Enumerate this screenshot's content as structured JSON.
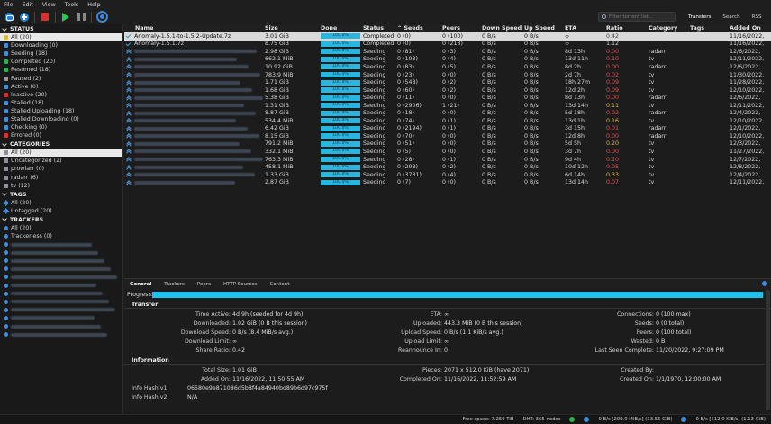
{
  "menu": {
    "file": "File",
    "edit": "Edit",
    "view": "View",
    "tools": "Tools",
    "help": "Help"
  },
  "search": {
    "placeholder": "Filter torrent list..."
  },
  "navtabs": {
    "transfers": "Transfers",
    "search": "Search",
    "rss": "RSS"
  },
  "sidebar": {
    "status_header": "STATUS",
    "status": [
      {
        "label": "All (20)",
        "color": "#e8b53a"
      },
      {
        "label": "Downloading (0)",
        "color": "#3a8fe0"
      },
      {
        "label": "Seeding (18)",
        "color": "#3a8fe0"
      },
      {
        "label": "Completed (20)",
        "color": "#2fb24c"
      },
      {
        "label": "Resumed (18)",
        "color": "#2fb24c"
      },
      {
        "label": "Paused (2)",
        "color": "#999999"
      },
      {
        "label": "Active (0)",
        "color": "#3a8fe0"
      },
      {
        "label": "Inactive (20)",
        "color": "#d9302c"
      },
      {
        "label": "Stalled (18)",
        "color": "#3a8fe0"
      },
      {
        "label": "Stalled Uploading (18)",
        "color": "#3a8fe0"
      },
      {
        "label": "Stalled Downloading (0)",
        "color": "#3a8fe0"
      },
      {
        "label": "Checking (0)",
        "color": "#3a8fe0"
      },
      {
        "label": "Errored (0)",
        "color": "#d9302c"
      }
    ],
    "categories_header": "CATEGORIES",
    "categories": [
      "All (20)",
      "Uncategorized (2)",
      "prowlarr (0)",
      "radarr (6)",
      "tv (12)"
    ],
    "tags_header": "TAGS",
    "tags": [
      "All (20)",
      "Untagged (20)"
    ],
    "trackers_header": "TRACKERS",
    "trackers": [
      "All (20)",
      "Trackerless (0)"
    ]
  },
  "columns": {
    "name": "Name",
    "size": "Size",
    "done": "Done",
    "status": "Status",
    "seeds": "Seeds",
    "peers": "Peers",
    "down": "Down Speed",
    "up": "Up Speed",
    "eta": "ETA",
    "ratio": "Ratio",
    "category": "Category",
    "tags": "Tags",
    "added": "Added On"
  },
  "rows": [
    {
      "name": "Anomaly-1.5.1-to-1.5.2-Update.7z",
      "size": "3.01 GiB",
      "done": "100.0%",
      "status": "Completed",
      "seeds": "0 (0)",
      "peers": "0 (100)",
      "down": "0 B/s",
      "up": "0 B/s",
      "eta": "∞",
      "ratio": "0.42",
      "ratio_color": "#444444",
      "category": "",
      "added": "11/16/2022,"
    },
    {
      "name": "Anomaly-1.5.1.7z",
      "size": "8.75 GiB",
      "done": "100.0%",
      "status": "Completed",
      "seeds": "0 (0)",
      "peers": "0 (213)",
      "down": "0 B/s",
      "up": "0 B/s",
      "eta": "∞",
      "ratio": "1.12",
      "ratio_color": "#d4d4d4",
      "category": "",
      "added": "11/16/2022,"
    },
    {
      "name": "",
      "size": "2.98 GiB",
      "done": "100.0%",
      "status": "Seeding",
      "seeds": "0 (81)",
      "peers": "0 (3)",
      "down": "0 B/s",
      "up": "0 B/s",
      "eta": "8d 13h",
      "ratio": "0.00",
      "ratio_color": "#e05050",
      "category": "radarr",
      "added": "12/6/2022,"
    },
    {
      "name": "",
      "size": "662.1 MiB",
      "done": "100.0%",
      "status": "Seeding",
      "seeds": "0 (193)",
      "peers": "0 (4)",
      "down": "0 B/s",
      "up": "0 B/s",
      "eta": "13d 11h",
      "ratio": "0.10",
      "ratio_color": "#e05050",
      "category": "tv",
      "added": "12/11/2022,"
    },
    {
      "name": "",
      "size": "10.92 GiB",
      "done": "100.0%",
      "status": "Seeding",
      "seeds": "0 (83)",
      "peers": "0 (5)",
      "down": "0 B/s",
      "up": "0 B/s",
      "eta": "8d 2h",
      "ratio": "0.00",
      "ratio_color": "#e05050",
      "category": "radarr",
      "added": "12/6/2022,"
    },
    {
      "name": "",
      "size": "783.9 MiB",
      "done": "100.0%",
      "status": "Seeding",
      "seeds": "0 (23)",
      "peers": "0 (0)",
      "down": "0 B/s",
      "up": "0 B/s",
      "eta": "2d 7h",
      "ratio": "0.02",
      "ratio_color": "#e05050",
      "category": "tv",
      "added": "11/30/2022,"
    },
    {
      "name": "",
      "size": "1.71 GiB",
      "done": "100.0%",
      "status": "Seeding",
      "seeds": "0 (548)",
      "peers": "0 (2)",
      "down": "0 B/s",
      "up": "0 B/s",
      "eta": "18h 27m",
      "ratio": "0.09",
      "ratio_color": "#e05050",
      "category": "tv",
      "added": "11/28/2022,"
    },
    {
      "name": "",
      "size": "1.68 GiB",
      "done": "100.0%",
      "status": "Seeding",
      "seeds": "0 (60)",
      "peers": "0 (2)",
      "down": "0 B/s",
      "up": "0 B/s",
      "eta": "12d 2h",
      "ratio": "0.09",
      "ratio_color": "#e05050",
      "category": "tv",
      "added": "12/10/2022,"
    },
    {
      "name": "",
      "size": "5.38 GiB",
      "done": "100.0%",
      "status": "Seeding",
      "seeds": "0 (11)",
      "peers": "0 (0)",
      "down": "0 B/s",
      "up": "0 B/s",
      "eta": "8d 13h",
      "ratio": "0.00",
      "ratio_color": "#e05050",
      "category": "radarr",
      "added": "12/6/2022,"
    },
    {
      "name": "",
      "size": "1.31 GiB",
      "done": "100.0%",
      "status": "Seeding",
      "seeds": "0 (2906)",
      "peers": "1 (21)",
      "down": "0 B/s",
      "up": "0 B/s",
      "eta": "13d 14h",
      "ratio": "0.11",
      "ratio_color": "#e6b84a",
      "category": "tv",
      "added": "12/11/2022,"
    },
    {
      "name": "",
      "size": "8.87 GiB",
      "done": "100.0%",
      "status": "Seeding",
      "seeds": "0 (18)",
      "peers": "0 (0)",
      "down": "0 B/s",
      "up": "0 B/s",
      "eta": "5d 18h",
      "ratio": "0.02",
      "ratio_color": "#e05050",
      "category": "radarr",
      "added": "12/4/2022,"
    },
    {
      "name": "",
      "size": "534.4 MiB",
      "done": "100.0%",
      "status": "Seeding",
      "seeds": "0 (74)",
      "peers": "0 (1)",
      "down": "0 B/s",
      "up": "0 B/s",
      "eta": "13d 1h",
      "ratio": "0.16",
      "ratio_color": "#e6b84a",
      "category": "tv",
      "added": "12/10/2022,"
    },
    {
      "name": "",
      "size": "6.42 GiB",
      "done": "100.0%",
      "status": "Seeding",
      "seeds": "0 (2194)",
      "peers": "0 (1)",
      "down": "0 B/s",
      "up": "0 B/s",
      "eta": "3d 15h",
      "ratio": "0.01",
      "ratio_color": "#e05050",
      "category": "radarr",
      "added": "12/1/2022,"
    },
    {
      "name": "",
      "size": "8.15 GiB",
      "done": "100.0%",
      "status": "Seeding",
      "seeds": "0 (70)",
      "peers": "0 (0)",
      "down": "0 B/s",
      "up": "0 B/s",
      "eta": "12d 8h",
      "ratio": "0.00",
      "ratio_color": "#e05050",
      "category": "radarr",
      "added": "12/10/2022,"
    },
    {
      "name": "",
      "size": "791.2 MiB",
      "done": "100.0%",
      "status": "Seeding",
      "seeds": "0 (51)",
      "peers": "0 (0)",
      "down": "0 B/s",
      "up": "0 B/s",
      "eta": "5d 5h",
      "ratio": "0.20",
      "ratio_color": "#e6b84a",
      "category": "tv",
      "added": "12/3/2022,"
    },
    {
      "name": "",
      "size": "332.1 MiB",
      "done": "100.0%",
      "status": "Seeding",
      "seeds": "0 (5)",
      "peers": "0 (0)",
      "down": "0 B/s",
      "up": "0 B/s",
      "eta": "3d 7h",
      "ratio": "0.00",
      "ratio_color": "#e05050",
      "category": "tv",
      "added": "11/27/2022,"
    },
    {
      "name": "",
      "size": "763.3 MiB",
      "done": "100.0%",
      "status": "Seeding",
      "seeds": "0 (28)",
      "peers": "0 (1)",
      "down": "0 B/s",
      "up": "0 B/s",
      "eta": "9d 4h",
      "ratio": "0.10",
      "ratio_color": "#e05050",
      "category": "tv",
      "added": "12/7/2022,"
    },
    {
      "name": "",
      "size": "458.1 MiB",
      "done": "100.0%",
      "status": "Seeding",
      "seeds": "0 (298)",
      "peers": "0 (2)",
      "down": "0 B/s",
      "up": "0 B/s",
      "eta": "10d 12h",
      "ratio": "0.05",
      "ratio_color": "#e05050",
      "category": "tv",
      "added": "12/8/2022,"
    },
    {
      "name": "",
      "size": "1.33 GiB",
      "done": "100.0%",
      "status": "Seeding",
      "seeds": "0 (3731)",
      "peers": "0 (4)",
      "down": "0 B/s",
      "up": "0 B/s",
      "eta": "6d 14h",
      "ratio": "0.33",
      "ratio_color": "#e6b84a",
      "category": "tv",
      "added": "12/4/2022,"
    },
    {
      "name": "",
      "size": "2.87 GiB",
      "done": "100.0%",
      "status": "Seeding",
      "seeds": "0 (7)",
      "peers": "0 (0)",
      "down": "0 B/s",
      "up": "0 B/s",
      "eta": "13d 14h",
      "ratio": "0.07",
      "ratio_color": "#e05050",
      "category": "tv",
      "added": "12/11/2022,"
    }
  ],
  "details": {
    "tabs": [
      "General",
      "Trackers",
      "Peers",
      "HTTP Sources",
      "Content"
    ],
    "progress_label": "Progress:",
    "transfer_header": "Transfer",
    "transfer": [
      [
        "Time Active:",
        "4d 9h (seeded for 4d 9h)",
        "ETA:",
        "∞",
        "Connections:",
        "0 (100 max)"
      ],
      [
        "Downloaded:",
        "1.02 GiB (0 B this session)",
        "Uploaded:",
        "443.3 MiB (0 B this session)",
        "Seeds:",
        "0 (0 total)"
      ],
      [
        "Download Speed:",
        "0 B/s (8.4 MiB/s avg.)",
        "Upload Speed:",
        "0 B/s (1.1 KiB/s avg.)",
        "Peers:",
        "0 (100 total)"
      ],
      [
        "Download Limit:",
        "∞",
        "Upload Limit:",
        "∞",
        "Wasted:",
        "0 B"
      ],
      [
        "Share Ratio:",
        "0.42",
        "Reannounce In:",
        "0",
        "Last Seen Complete:",
        "11/20/2022, 9:27:09 PM"
      ]
    ],
    "info_header": "Information",
    "info": [
      [
        "Total Size:",
        "1.01 GiB",
        "Pieces:",
        "2071 x 512.0 KiB (have 2071)",
        "Created By:",
        ""
      ],
      [
        "Added On:",
        "11/16/2022, 11:50:55 AM",
        "Completed On:",
        "11/16/2022, 11:52:59 AM",
        "Created On:",
        "1/1/1970, 12:00:00 AM"
      ],
      [
        "Info Hash v1:",
        "06580e9e871086d5b8f4a84940bd89b6d97c975f",
        "",
        "",
        "",
        ""
      ],
      [
        "Info Hash v2:",
        "N/A",
        "",
        "",
        "",
        ""
      ]
    ]
  },
  "statusbar": {
    "free_space": "Free space: 7.259 TiB",
    "dht": "DHT: 365 nodes",
    "down": "0 B/s [200.0 MiB/s] (13.55 GiB)",
    "up": "0 B/s [512.0 KiB/s] (1.13 GiB)"
  }
}
